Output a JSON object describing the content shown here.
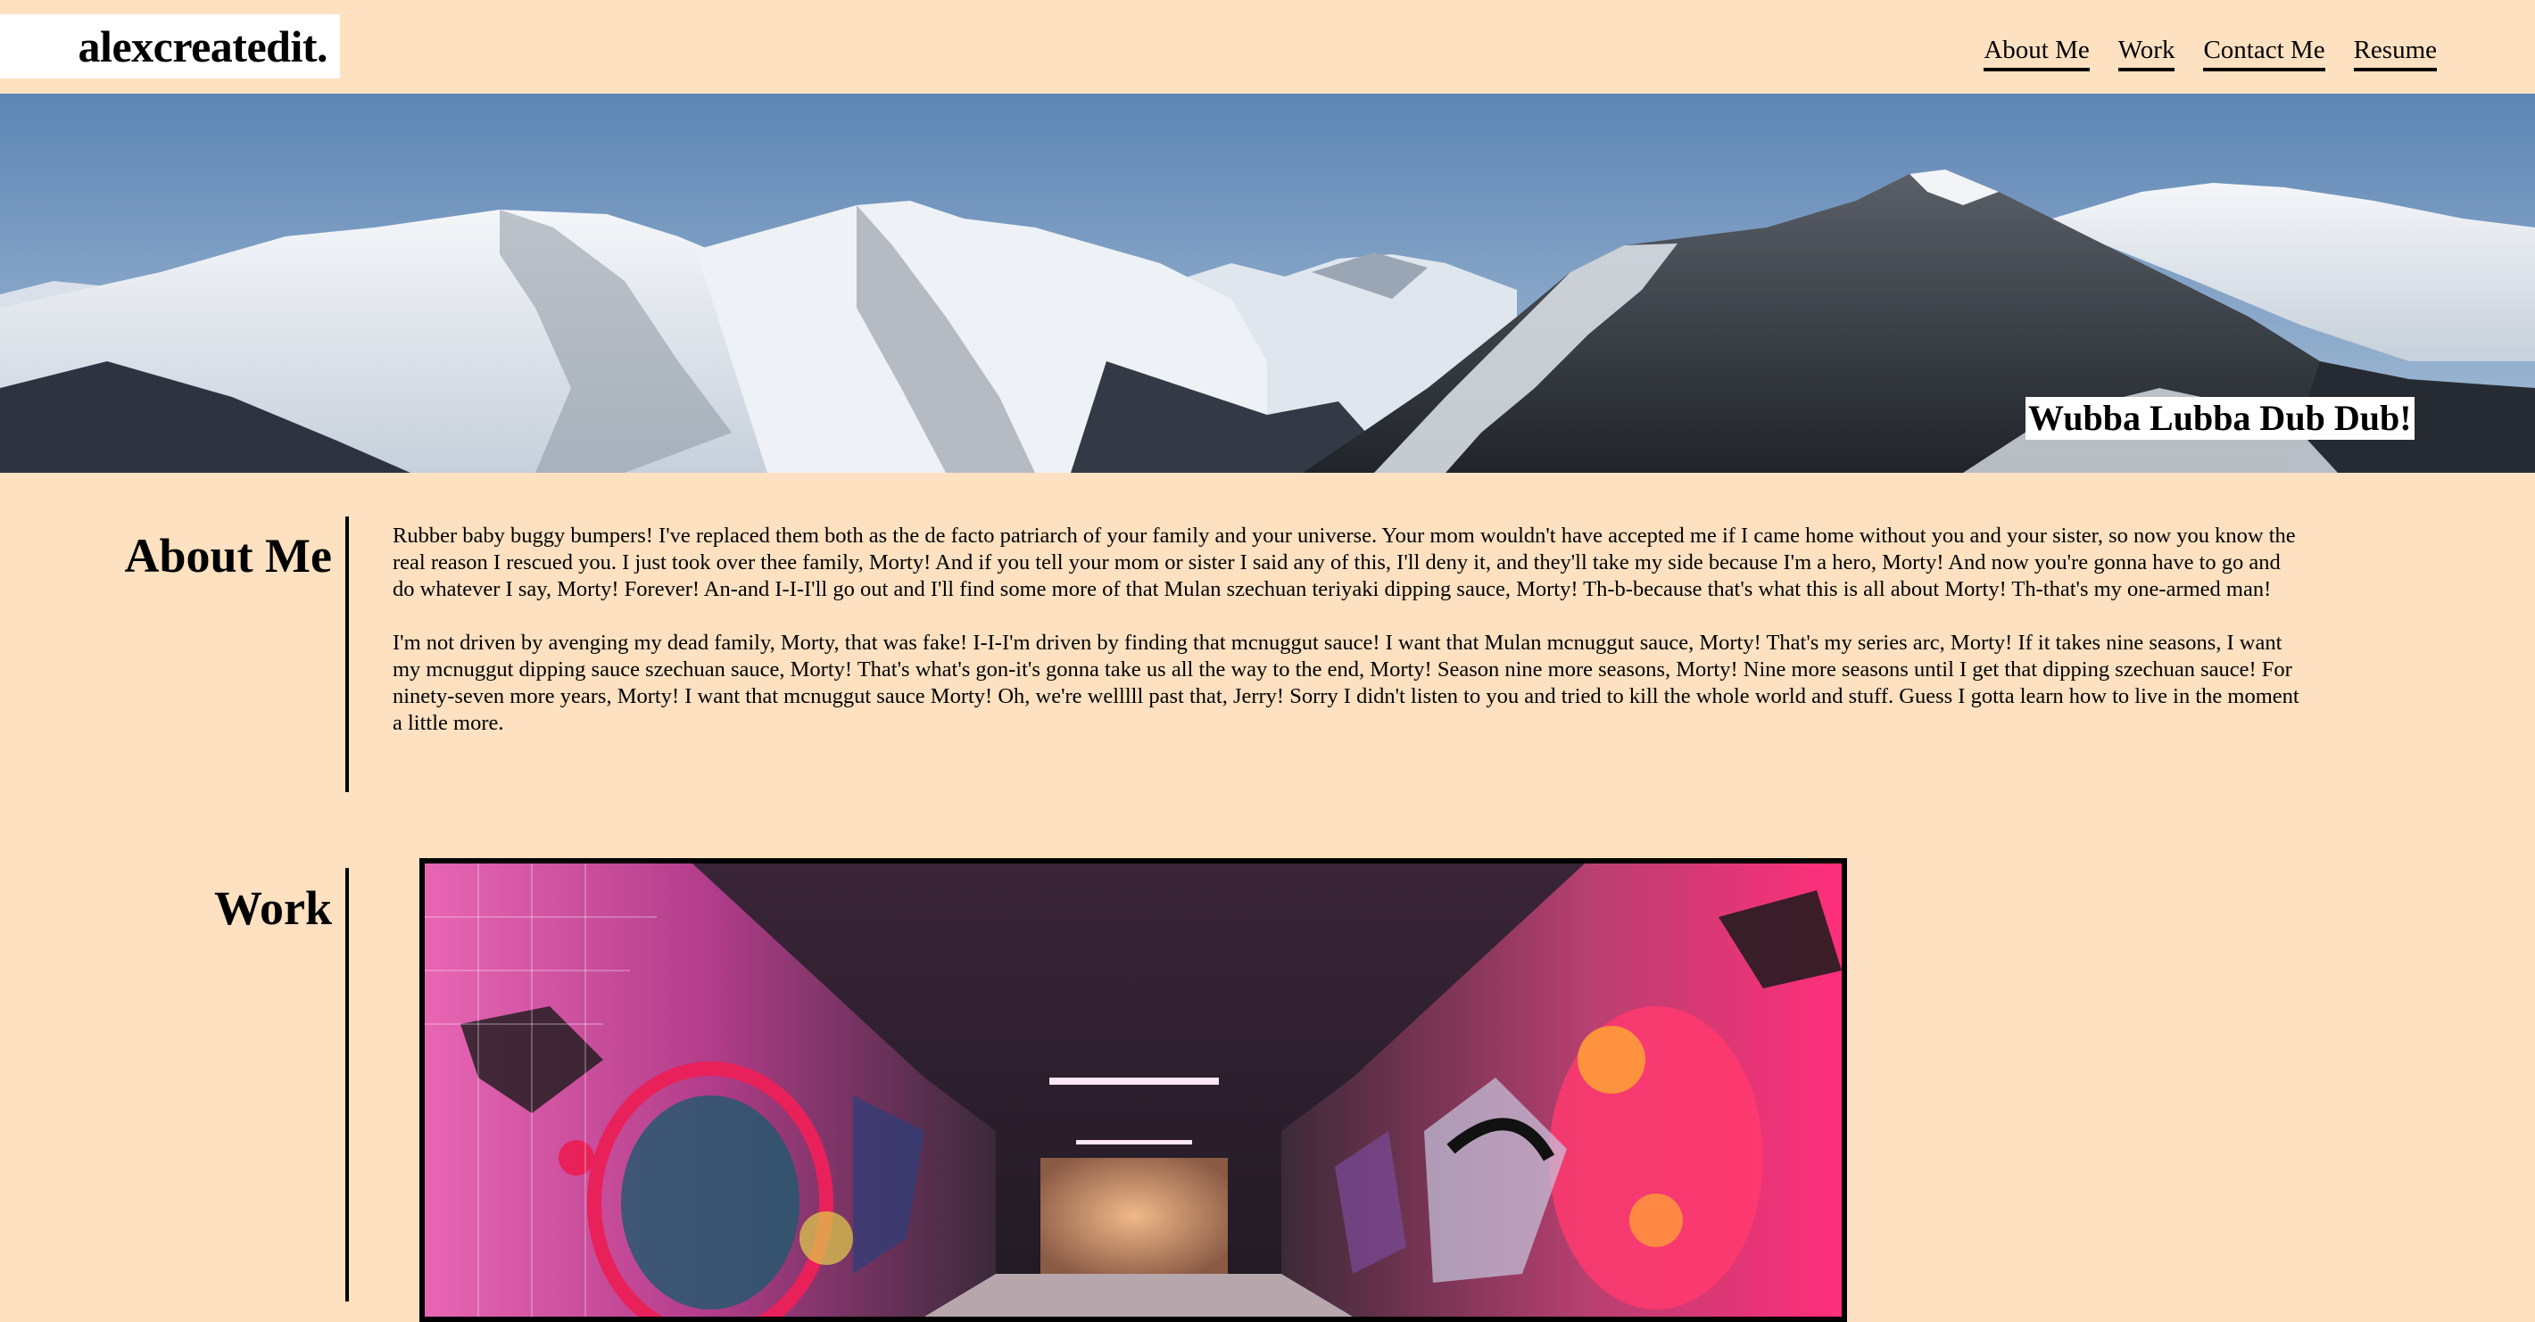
{
  "header": {
    "logo_text": "alexcreatedit.",
    "nav": [
      {
        "label": "About Me"
      },
      {
        "label": "Work"
      },
      {
        "label": "Contact Me"
      },
      {
        "label": "Resume"
      }
    ]
  },
  "hero": {
    "caption": "Wubba Lubba Dub Dub!",
    "image_alt": "snowy mountain panorama"
  },
  "about": {
    "title": "About Me",
    "paragraphs": [
      "Rubber baby buggy bumpers! I've replaced them both as the de facto patriarch of your family and your universe. Your mom wouldn't have accepted me if I came home without you and your sister, so now you know the real reason I rescued you. I just took over thee family, Morty! And if you tell your mom or sister I said any of this, I'll deny it, and they'll take my side because I'm a hero, Morty! And now you're gonna have to go and do whatever I say, Morty! Forever! An-and I-I-I'll go out and I'll find some more of that Mulan szechuan teriyaki dipping sauce, Morty! Th-b-because that's what this is all about Morty! Th-that's my one-armed man!",
      "I'm not driven by avenging my dead family, Morty, that was fake! I-I-I'm driven by finding that mcnuggut sauce! I want that Mulan mcnuggut sauce, Morty! That's my series arc, Morty! If it takes nine seasons, I want my mcnuggut dipping sauce szechuan sauce, Morty! That's what's gon-it's gonna take us all the way to the end, Morty! Season nine more seasons, Morty! Nine more seasons until I get that dipping szechuan sauce! For ninety-seven more years, Morty! I want that mcnuggut sauce Morty! Oh, we're welllll past that, Jerry! Sorry I didn't listen to you and tried to kill the whole world and stuff. Guess I gotta learn how to live in the moment a little more."
    ]
  },
  "work": {
    "title": "Work",
    "image_alt": "graffiti-covered tunnel"
  },
  "colors": {
    "page_background": "#fee1c0",
    "text": "#000000",
    "label_background": "#ffffff"
  }
}
